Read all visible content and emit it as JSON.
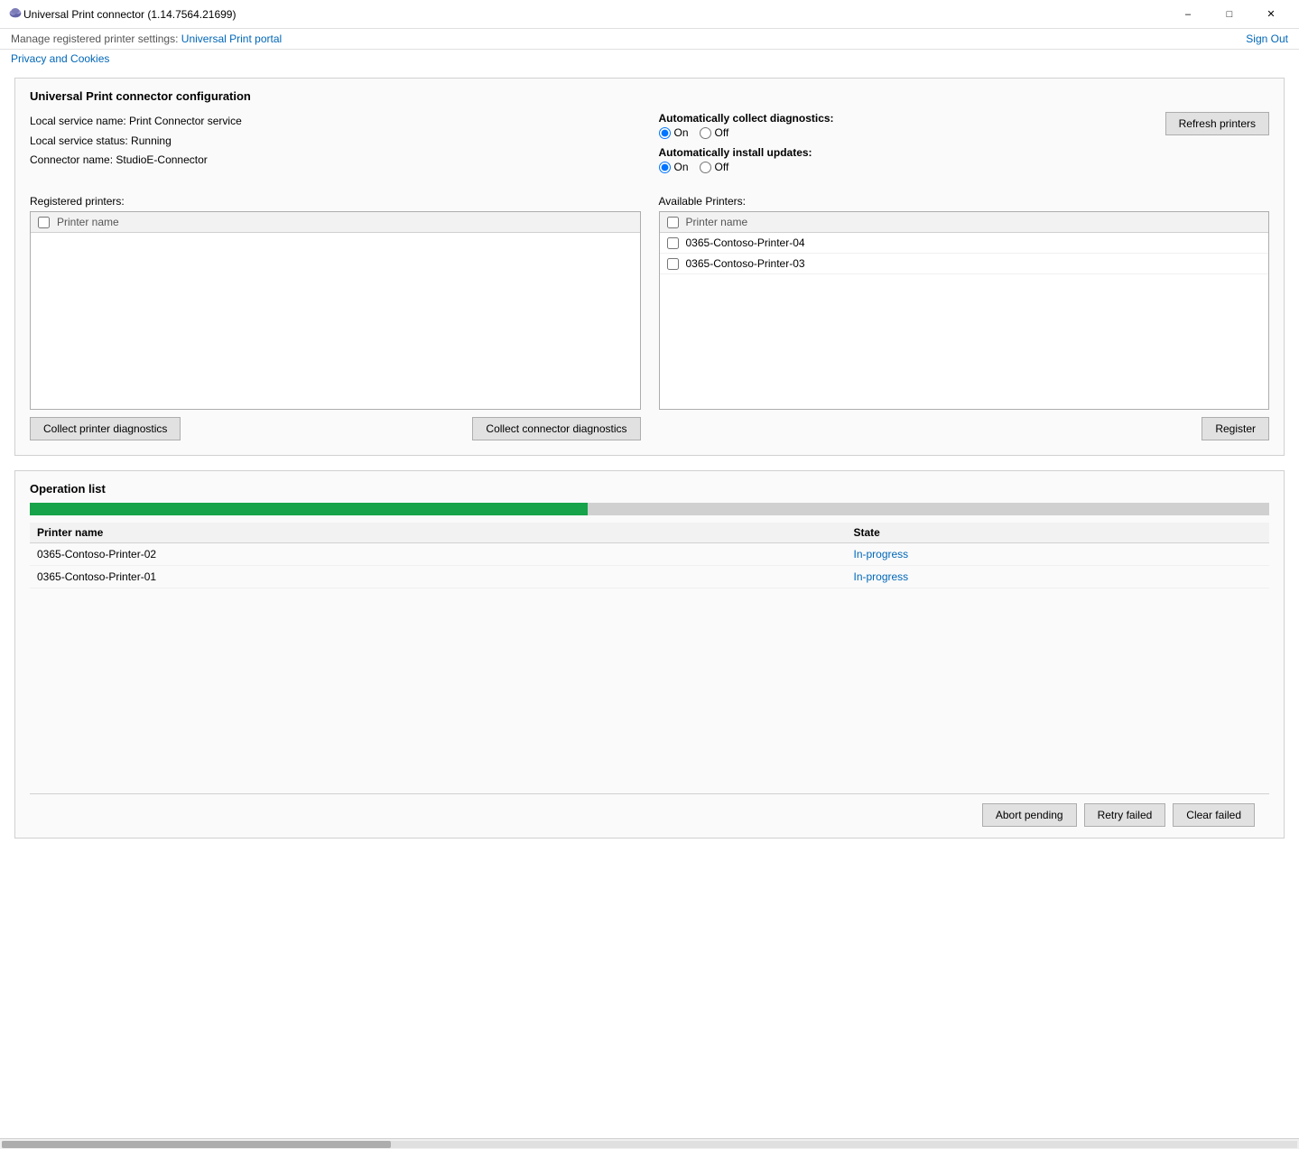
{
  "window": {
    "title": "Universal Print connector (1.14.7564.21699)",
    "minimize_label": "–",
    "maximize_label": "□",
    "close_label": "✕"
  },
  "header": {
    "manage_text": "Manage registered printer settings:",
    "portal_link": "Universal Print portal",
    "sign_out_label": "Sign Out"
  },
  "privacy_link": "Privacy and Cookies",
  "config": {
    "section_title": "Universal Print connector configuration",
    "local_service_name_label": "Local service name: Print Connector service",
    "local_service_status_label": "Local service status: Running",
    "connector_name_label": "Connector name: StudioE-Connector",
    "auto_collect_diag_label": "Automatically collect diagnostics:",
    "auto_install_updates_label": "Automatically install updates:",
    "on_label": "On",
    "off_label": "Off",
    "refresh_printers_btn": "Refresh printers"
  },
  "registered_printers": {
    "label": "Registered printers:",
    "col_header": "Printer name",
    "items": []
  },
  "available_printers": {
    "label": "Available Printers:",
    "col_header": "Printer name",
    "items": [
      {
        "name": "0365-Contoso-Printer-04"
      },
      {
        "name": "0365-Contoso-Printer-03"
      }
    ]
  },
  "actions": {
    "collect_printer_diagnostics": "Collect printer diagnostics",
    "collect_connector_diagnostics": "Collect connector diagnostics",
    "register_btn": "Register"
  },
  "operation_list": {
    "section_title": "Operation list",
    "progress_percent": 45,
    "col_printer": "Printer name",
    "col_state": "State",
    "items": [
      {
        "printer": "0365-Contoso-Printer-02",
        "state": "In-progress",
        "state_type": "inprogress"
      },
      {
        "printer": "0365-Contoso-Printer-01",
        "state": "In-progress",
        "state_type": "inprogress"
      }
    ]
  },
  "bottom_actions": {
    "abort_pending": "Abort pending",
    "retry_failed": "Retry failed",
    "clear_failed": "Clear failed"
  }
}
